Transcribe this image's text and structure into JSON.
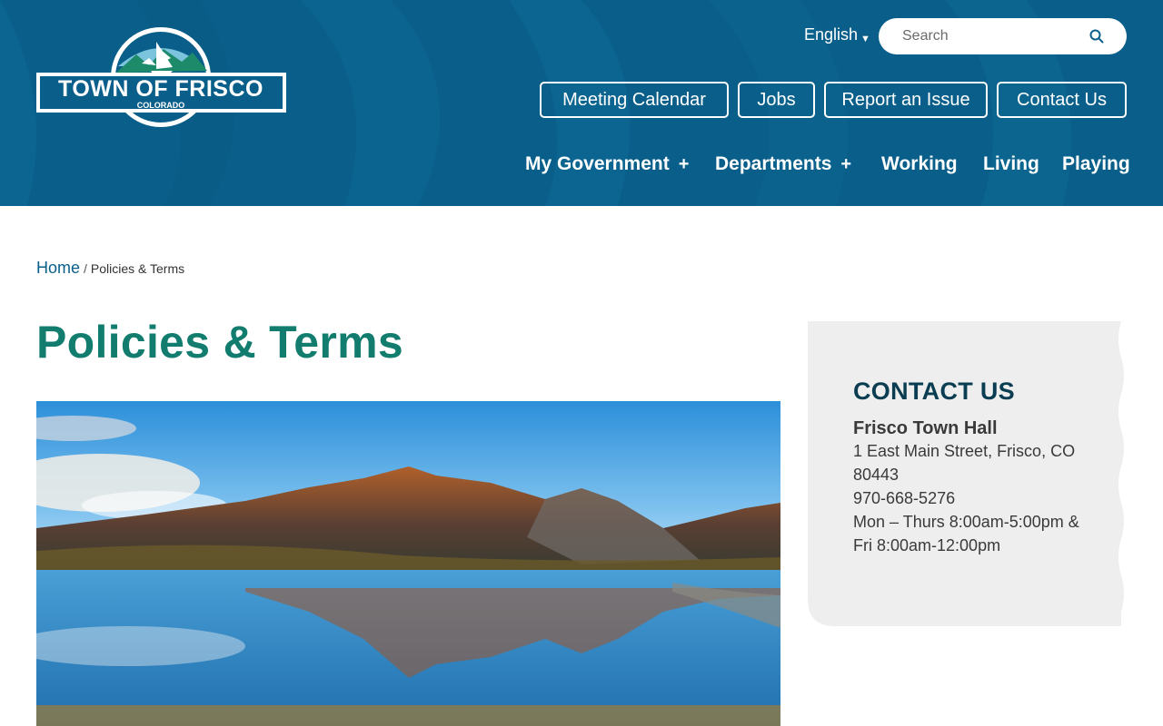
{
  "header": {
    "logo": {
      "main_text": "TOWN OF FRISCO",
      "sub_text": "COLORADO"
    },
    "language": {
      "label": "English"
    },
    "search": {
      "placeholder": "Search"
    },
    "quick_links": [
      {
        "label": "Meeting Calendar"
      },
      {
        "label": "Jobs"
      },
      {
        "label": "Report an Issue"
      },
      {
        "label": "Contact Us"
      }
    ],
    "main_nav": [
      {
        "label": "My Government",
        "expand_icon": "+"
      },
      {
        "label": "Departments",
        "expand_icon": "+"
      },
      {
        "label": "Working"
      },
      {
        "label": "Living"
      },
      {
        "label": "Playing"
      }
    ]
  },
  "breadcrumb": {
    "home": "Home",
    "separator": "/",
    "current": "Policies & Terms"
  },
  "page": {
    "title": "Policies & Terms"
  },
  "contact": {
    "heading": "CONTACT US",
    "place": "Frisco Town Hall",
    "address_line1": "1 East Main Street, Frisco, CO",
    "address_line2": "80443",
    "phone": "970-668-5276",
    "hours_line1": "Mon – Thurs 8:00am-5:00pm &",
    "hours_line2": "Fri 8:00am-12:00pm"
  },
  "colors": {
    "header_bg": "#0a5f8a",
    "title_green": "#127d6f",
    "contact_heading": "#0b3d52",
    "card_bg": "#eeeeee"
  },
  "icons": {
    "search": "search-icon",
    "language_caret": "caret-down-icon",
    "nav_expand": "plus-icon"
  }
}
